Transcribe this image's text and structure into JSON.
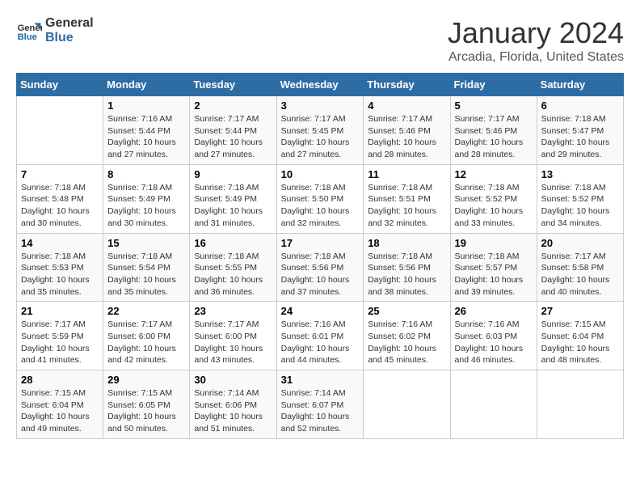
{
  "header": {
    "logo_line1": "General",
    "logo_line2": "Blue",
    "title": "January 2024",
    "subtitle": "Arcadia, Florida, United States"
  },
  "days_of_week": [
    "Sunday",
    "Monday",
    "Tuesday",
    "Wednesday",
    "Thursday",
    "Friday",
    "Saturday"
  ],
  "weeks": [
    [
      {
        "num": "",
        "info": ""
      },
      {
        "num": "1",
        "info": "Sunrise: 7:16 AM\nSunset: 5:44 PM\nDaylight: 10 hours\nand 27 minutes."
      },
      {
        "num": "2",
        "info": "Sunrise: 7:17 AM\nSunset: 5:44 PM\nDaylight: 10 hours\nand 27 minutes."
      },
      {
        "num": "3",
        "info": "Sunrise: 7:17 AM\nSunset: 5:45 PM\nDaylight: 10 hours\nand 27 minutes."
      },
      {
        "num": "4",
        "info": "Sunrise: 7:17 AM\nSunset: 5:46 PM\nDaylight: 10 hours\nand 28 minutes."
      },
      {
        "num": "5",
        "info": "Sunrise: 7:17 AM\nSunset: 5:46 PM\nDaylight: 10 hours\nand 28 minutes."
      },
      {
        "num": "6",
        "info": "Sunrise: 7:18 AM\nSunset: 5:47 PM\nDaylight: 10 hours\nand 29 minutes."
      }
    ],
    [
      {
        "num": "7",
        "info": "Sunrise: 7:18 AM\nSunset: 5:48 PM\nDaylight: 10 hours\nand 30 minutes."
      },
      {
        "num": "8",
        "info": "Sunrise: 7:18 AM\nSunset: 5:49 PM\nDaylight: 10 hours\nand 30 minutes."
      },
      {
        "num": "9",
        "info": "Sunrise: 7:18 AM\nSunset: 5:49 PM\nDaylight: 10 hours\nand 31 minutes."
      },
      {
        "num": "10",
        "info": "Sunrise: 7:18 AM\nSunset: 5:50 PM\nDaylight: 10 hours\nand 32 minutes."
      },
      {
        "num": "11",
        "info": "Sunrise: 7:18 AM\nSunset: 5:51 PM\nDaylight: 10 hours\nand 32 minutes."
      },
      {
        "num": "12",
        "info": "Sunrise: 7:18 AM\nSunset: 5:52 PM\nDaylight: 10 hours\nand 33 minutes."
      },
      {
        "num": "13",
        "info": "Sunrise: 7:18 AM\nSunset: 5:52 PM\nDaylight: 10 hours\nand 34 minutes."
      }
    ],
    [
      {
        "num": "14",
        "info": "Sunrise: 7:18 AM\nSunset: 5:53 PM\nDaylight: 10 hours\nand 35 minutes."
      },
      {
        "num": "15",
        "info": "Sunrise: 7:18 AM\nSunset: 5:54 PM\nDaylight: 10 hours\nand 35 minutes."
      },
      {
        "num": "16",
        "info": "Sunrise: 7:18 AM\nSunset: 5:55 PM\nDaylight: 10 hours\nand 36 minutes."
      },
      {
        "num": "17",
        "info": "Sunrise: 7:18 AM\nSunset: 5:56 PM\nDaylight: 10 hours\nand 37 minutes."
      },
      {
        "num": "18",
        "info": "Sunrise: 7:18 AM\nSunset: 5:56 PM\nDaylight: 10 hours\nand 38 minutes."
      },
      {
        "num": "19",
        "info": "Sunrise: 7:18 AM\nSunset: 5:57 PM\nDaylight: 10 hours\nand 39 minutes."
      },
      {
        "num": "20",
        "info": "Sunrise: 7:17 AM\nSunset: 5:58 PM\nDaylight: 10 hours\nand 40 minutes."
      }
    ],
    [
      {
        "num": "21",
        "info": "Sunrise: 7:17 AM\nSunset: 5:59 PM\nDaylight: 10 hours\nand 41 minutes."
      },
      {
        "num": "22",
        "info": "Sunrise: 7:17 AM\nSunset: 6:00 PM\nDaylight: 10 hours\nand 42 minutes."
      },
      {
        "num": "23",
        "info": "Sunrise: 7:17 AM\nSunset: 6:00 PM\nDaylight: 10 hours\nand 43 minutes."
      },
      {
        "num": "24",
        "info": "Sunrise: 7:16 AM\nSunset: 6:01 PM\nDaylight: 10 hours\nand 44 minutes."
      },
      {
        "num": "25",
        "info": "Sunrise: 7:16 AM\nSunset: 6:02 PM\nDaylight: 10 hours\nand 45 minutes."
      },
      {
        "num": "26",
        "info": "Sunrise: 7:16 AM\nSunset: 6:03 PM\nDaylight: 10 hours\nand 46 minutes."
      },
      {
        "num": "27",
        "info": "Sunrise: 7:15 AM\nSunset: 6:04 PM\nDaylight: 10 hours\nand 48 minutes."
      }
    ],
    [
      {
        "num": "28",
        "info": "Sunrise: 7:15 AM\nSunset: 6:04 PM\nDaylight: 10 hours\nand 49 minutes."
      },
      {
        "num": "29",
        "info": "Sunrise: 7:15 AM\nSunset: 6:05 PM\nDaylight: 10 hours\nand 50 minutes."
      },
      {
        "num": "30",
        "info": "Sunrise: 7:14 AM\nSunset: 6:06 PM\nDaylight: 10 hours\nand 51 minutes."
      },
      {
        "num": "31",
        "info": "Sunrise: 7:14 AM\nSunset: 6:07 PM\nDaylight: 10 hours\nand 52 minutes."
      },
      {
        "num": "",
        "info": ""
      },
      {
        "num": "",
        "info": ""
      },
      {
        "num": "",
        "info": ""
      }
    ]
  ]
}
